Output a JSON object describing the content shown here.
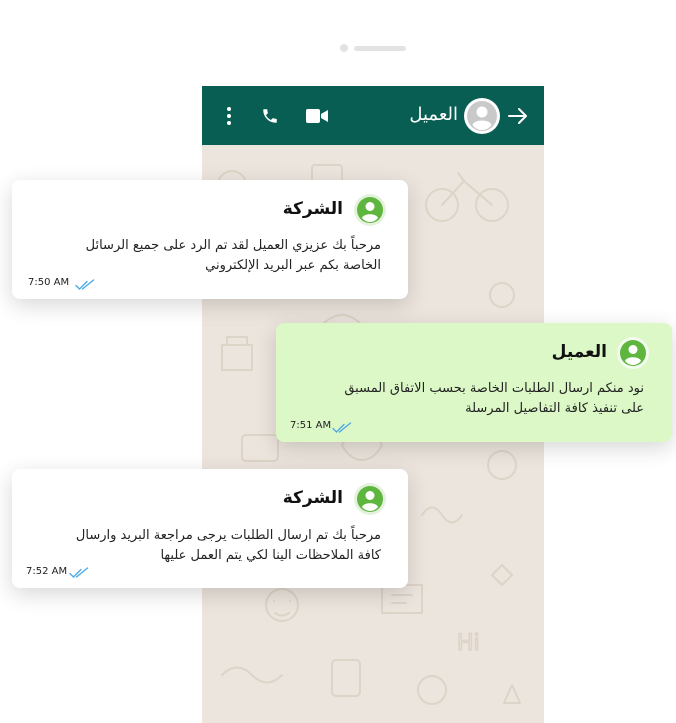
{
  "header": {
    "contact_name": "العميل",
    "icons": [
      "back-arrow-icon",
      "contact-avatar-icon",
      "video-call-icon",
      "voice-call-icon",
      "more-options-icon"
    ]
  },
  "messages": [
    {
      "sender": "الشركة",
      "line1": "مرحباً بك عزيزي العميل لقد تم الرد على جميع الرسائل",
      "line2": "الخاصة بكم عبر البريد  الإلكتروني",
      "time": "7:50 AM",
      "status": "read"
    },
    {
      "sender": "العميل",
      "line1": "نود منكم ارسال الطلبات الخاصة بحسب الاتفاق المسبق",
      "line2": "على تنفيذ كافة التفاصيل المرسلة",
      "time": "7:51 AM",
      "status": "read"
    },
    {
      "sender": "الشركة",
      "line1": "مرحباً بك تم ارسال الطلبات يرجى مراجعة البريد وارسال",
      "line2": "كافة الملاحظات الينا لكي يتم العمل عليها",
      "time": "7:52 AM",
      "status": "read"
    }
  ],
  "colors": {
    "header_bg": "#095e54",
    "chat_bg": "#ece5dd",
    "incoming_bubble": "#ffffff",
    "outgoing_bubble": "#dbf8c6",
    "avatar_green": "#5fb63f",
    "read_ticks": "#4fa9e6"
  }
}
